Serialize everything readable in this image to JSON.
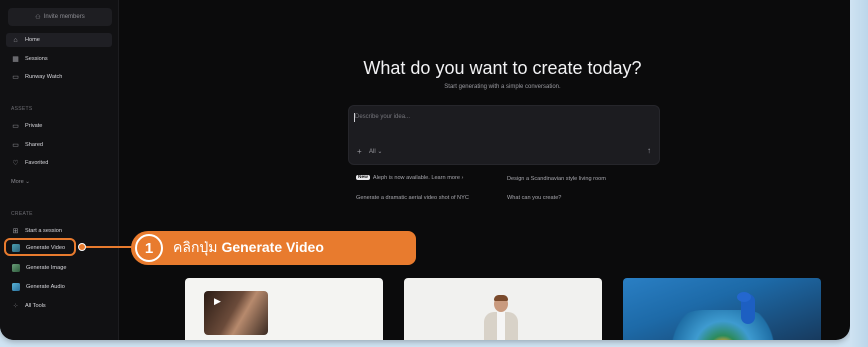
{
  "sidebar": {
    "invite_label": "Invite members",
    "items": [
      {
        "label": "Home",
        "icon": "home-icon",
        "active": true
      },
      {
        "label": "Sessions",
        "icon": "grid-icon"
      },
      {
        "label": "Runway Watch",
        "icon": "tv-icon"
      }
    ],
    "assets_label": "ASSETS",
    "assets": [
      {
        "label": "Private",
        "icon": "folder-icon"
      },
      {
        "label": "Shared",
        "icon": "shared-folder-icon"
      },
      {
        "label": "Favorited",
        "icon": "heart-icon"
      }
    ],
    "more_label": "More ⌄",
    "create_label": "CREATE",
    "create": [
      {
        "label": "Start a session",
        "icon": "plus-square-icon"
      },
      {
        "label": "Generate Video",
        "icon": "video-thumb-icon"
      },
      {
        "label": "Generate Image",
        "icon": "image-thumb-icon"
      },
      {
        "label": "Generate Audio",
        "icon": "audio-thumb-icon"
      },
      {
        "label": "All Tools",
        "icon": "tools-grid-icon"
      }
    ]
  },
  "callout": {
    "number": "1",
    "text_prefix": "คลิกปุ่ม ",
    "text_bold": "Generate Video",
    "color": "#e87b2e"
  },
  "main": {
    "title": "What do you want to create today?",
    "subtitle": "Start generating with a simple conversation.",
    "prompt_placeholder": "Describe your idea...",
    "add_icon": "+",
    "mode_label": "All ⌄",
    "send_icon": "↑",
    "new_badge": "New",
    "suggestions": [
      "Aleph is now available. Learn more ›",
      "Design a Scandinavian style living room",
      "Generate a dramatic aerial video shot of NYC",
      "What can you create?"
    ]
  }
}
